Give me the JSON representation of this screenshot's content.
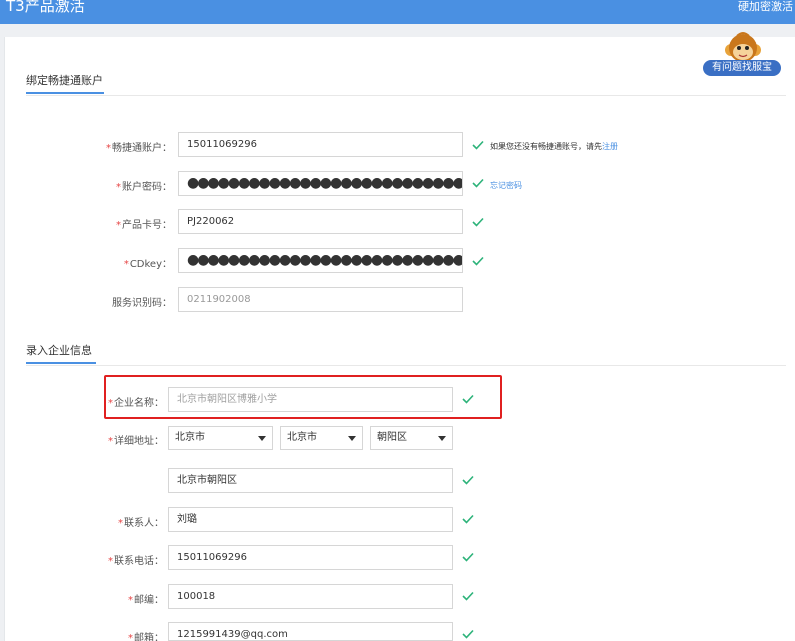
{
  "header": {
    "title": "T3产品激活",
    "right_link": "硬加密激活"
  },
  "help_badge": "有问题找服宝",
  "section1": {
    "title": "绑定畅捷通账户"
  },
  "section2": {
    "title": "录入企业信息"
  },
  "account": {
    "label": "畅捷通账户：",
    "value": "15011069296",
    "hint": "如果您还没有畅捷通账号，请先",
    "hint_link": "注册"
  },
  "password": {
    "label": "账户密码：",
    "value": "●●●●●●●●●●●●●●●●●●●●●●●●●●●●●●●●",
    "link": "忘记密码"
  },
  "product_card": {
    "label": "产品卡号：",
    "value": "PJ220062"
  },
  "cdkey": {
    "label": "CDkey：",
    "value": "●●●●●●●●●●●●●●●●●●●●●●●●●●●●●●●●"
  },
  "service_code": {
    "label": "服务识别码：",
    "value": "0211902008"
  },
  "company_name": {
    "label": "企业名称：",
    "placeholder": "北京市朝阳区博雅小学"
  },
  "address": {
    "label": "详细地址：",
    "province": "北京市",
    "city": "北京市",
    "district": "朝阳区",
    "detail": "北京市朝阳区"
  },
  "contact": {
    "label": "联系人：",
    "value": "刘璐"
  },
  "phone": {
    "label": "联系电话：",
    "value": "15011069296"
  },
  "postcode": {
    "label": "邮编：",
    "value": "100018"
  },
  "email": {
    "label": "邮箱：",
    "value": "1215991439@qq.com"
  },
  "required_mark": "*",
  "colors": {
    "accent": "#4a90e2",
    "check": "#2db37a",
    "required": "#e64545",
    "highlight": "#e02020"
  }
}
